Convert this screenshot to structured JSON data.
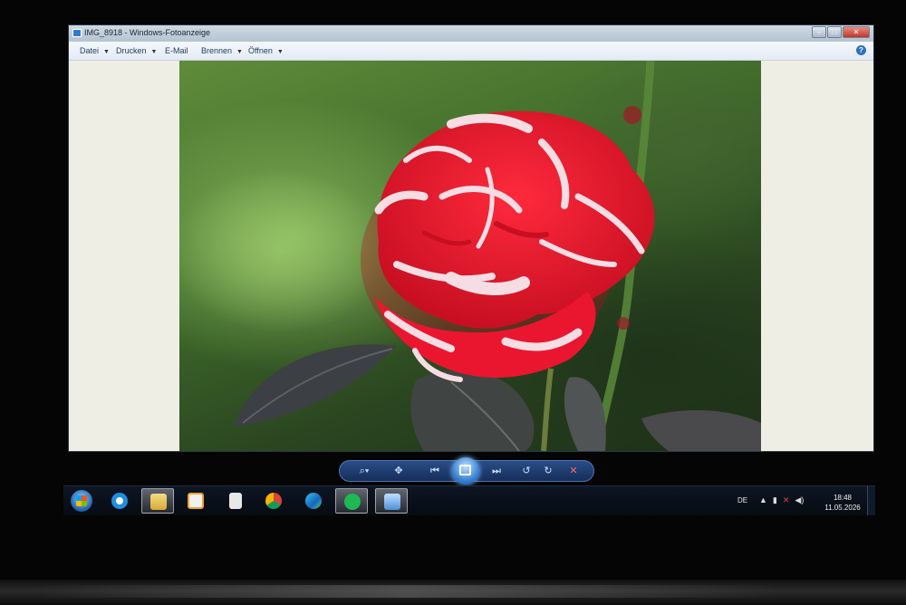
{
  "window": {
    "title": "IMG_8918 - Windows-Fotoanzeige",
    "controls": {
      "minimize": "–",
      "maximize": "□",
      "close": "✕"
    }
  },
  "menu": {
    "items": [
      {
        "label": "Datei",
        "has_dropdown": true
      },
      {
        "label": "Drucken",
        "has_dropdown": true
      },
      {
        "label": "E-Mail",
        "has_dropdown": false
      },
      {
        "label": "Brennen",
        "has_dropdown": true
      },
      {
        "label": "Öffnen",
        "has_dropdown": true
      }
    ],
    "help_label": "?"
  },
  "photo": {
    "subject": "red-and-white-striped-rose",
    "colors": {
      "petal_red": "#e8162c",
      "petal_white": "#f7e6ea",
      "leaf": "#3a3d3c",
      "background": "#3e6a2a"
    }
  },
  "viewer_toolbar": {
    "buttons": [
      {
        "icon": "zoom-icon",
        "glyph": "⌕▾"
      },
      {
        "icon": "actual-size-icon",
        "glyph": "✥"
      },
      {
        "icon": "previous-icon",
        "glyph": "⏮"
      },
      {
        "icon": "slideshow-icon",
        "glyph": ""
      },
      {
        "icon": "next-icon",
        "glyph": "⏭"
      },
      {
        "icon": "rotate-ccw-icon",
        "glyph": "↺"
      },
      {
        "icon": "rotate-cw-icon",
        "glyph": "↻"
      },
      {
        "icon": "delete-icon",
        "glyph": "✕"
      }
    ]
  },
  "taskbar": {
    "items": [
      {
        "name": "internet-explorer",
        "color": "#1e8fe0",
        "active": false
      },
      {
        "name": "file-explorer",
        "color": "#e7c85a",
        "active": true
      },
      {
        "name": "media-player",
        "color": "#f0a030",
        "active": false
      },
      {
        "name": "document",
        "color": "#e8e8e8",
        "active": false
      },
      {
        "name": "chrome",
        "color": "#db4437",
        "active": false
      },
      {
        "name": "edge",
        "color": "#2aa3d8",
        "active": false
      },
      {
        "name": "spotify",
        "color": "#1db954",
        "active": true
      },
      {
        "name": "photo-viewer",
        "color": "#7fb3e6",
        "active": true
      }
    ],
    "tray": {
      "language": "DE",
      "time": "18:48",
      "date": "11.05.2026"
    }
  }
}
